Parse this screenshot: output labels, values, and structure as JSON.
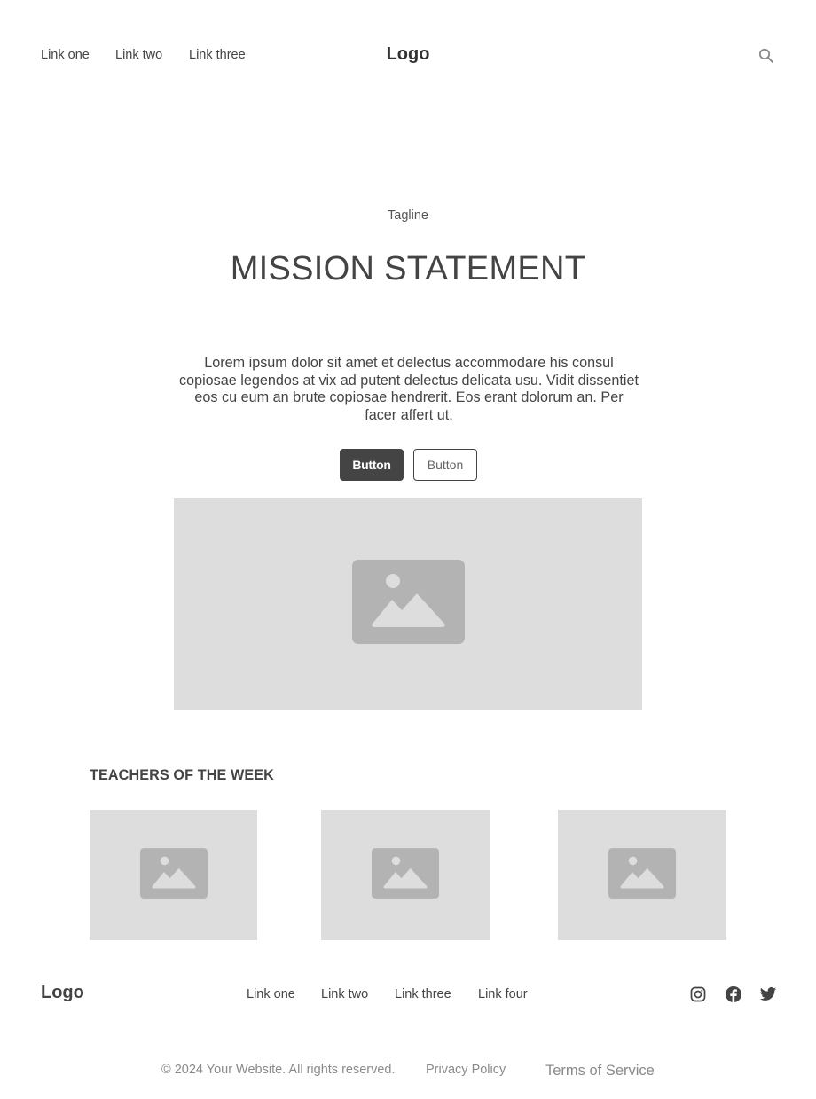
{
  "header": {
    "nav_links": [
      "Link one",
      "Link two",
      "Link three"
    ],
    "logo": "Logo",
    "search_icon": "search-icon"
  },
  "hero": {
    "tagline": "Tagline",
    "title": "MISSION STATEMENT",
    "body": "Lorem ipsum dolor sit amet et delectus accommodare his consul copiosae legendos at vix ad putent delectus delicata usu. Vidit dissentiet eos cu eum an brute copiosae hendrerit. Eos erant dolorum an. Per facer affert ut.",
    "primary_button": "Button",
    "secondary_button": "Button",
    "image_icon": "image-placeholder-icon"
  },
  "teachers": {
    "title": "TEACHERS OF THE WEEK",
    "cards": [
      "image-placeholder-icon",
      "image-placeholder-icon",
      "image-placeholder-icon"
    ]
  },
  "footer": {
    "logo": "Logo",
    "links": [
      "Link one",
      "Link two",
      "Link three",
      "Link four"
    ],
    "social_icons": [
      "instagram-icon",
      "facebook-icon",
      "twitter-icon"
    ],
    "copyright": "© 2024 Your Website. All rights reserved.",
    "privacy": "Privacy Policy",
    "terms": "Terms of Service"
  },
  "colors": {
    "primary_button_bg": "#444444",
    "placeholder_bg": "#dddddd",
    "placeholder_icon": "#b3b3b3",
    "muted_text": "#8a8a8a"
  }
}
